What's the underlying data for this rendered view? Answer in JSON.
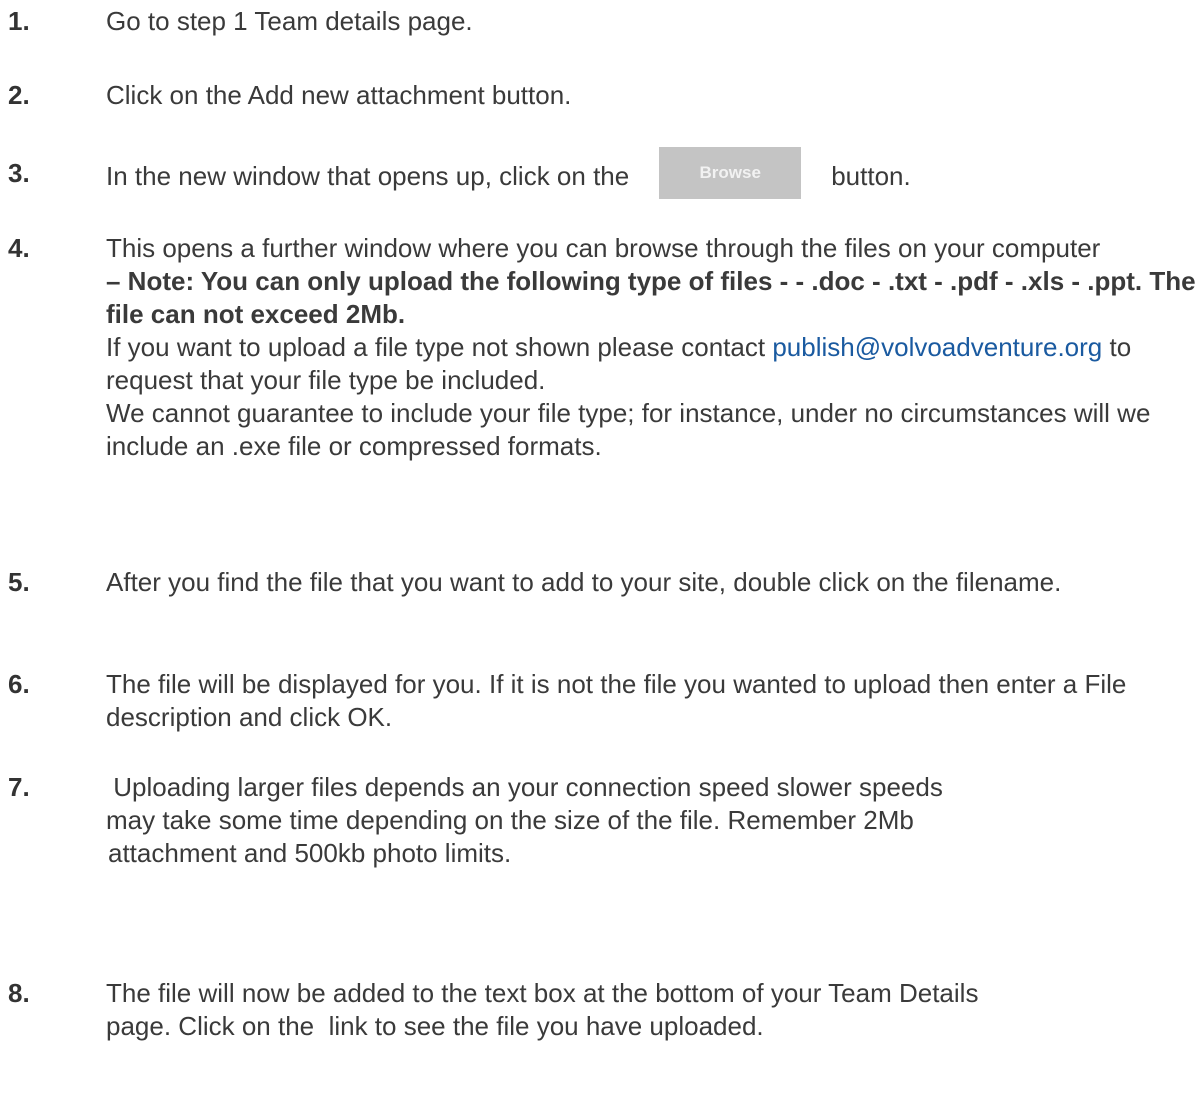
{
  "steps": [
    {
      "number": "1.",
      "text": "Go to step 1 Team details page."
    },
    {
      "number": "2.",
      "text": "Click on the Add new attachment button."
    },
    {
      "number": "3.",
      "text_before": "In the new window that opens up, click on the",
      "button_label": "Browse",
      "text_after": "button."
    },
    {
      "number": "4.",
      "intro": "This opens a further window where you can browse through the files on your computer",
      "note": "– Note:  You can only upload the following type of files - - .doc - .txt - .pdf - .xls - .ppt. The file can not exceed 2Mb.",
      "contact_before": "If you want to upload a file type not shown please contact",
      "email": "publish@volvoadventure.org",
      "contact_after": "to request that your file type be included.",
      "guarantee": "We cannot guarantee to include your file type; for instance, under no circumstances will we include an .exe file or compressed formats."
    },
    {
      "number": "5.",
      "text": "After you find the file that you want to add to your site, double click on the filename."
    },
    {
      "number": "6.",
      "text": "The file will be displayed for you. If it is not the file you wanted to upload then enter a File description and click OK."
    },
    {
      "number": "7.",
      "line1": " Uploading larger files depends an your connection speed slower speeds",
      "line2": "may take some time depending on the size of the file. Remember 2Mb",
      "line3": "attachment and 500kb photo limits."
    },
    {
      "number": "8.",
      "text": "The file will now be added to the text box at the bottom of your Team Details page. Click on the  link to see the file you have uploaded."
    }
  ],
  "colors": {
    "text": "#3a3a3a",
    "link": "#1a5aa0",
    "button_bg": "#c4c4c4",
    "button_text": "#f2f2f2"
  }
}
